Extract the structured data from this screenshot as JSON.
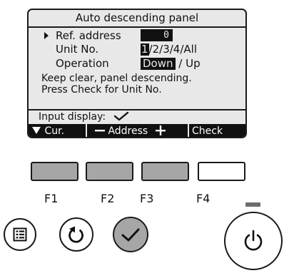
{
  "screen": {
    "title": "Auto descending panel",
    "ref_address_label": "Ref. address",
    "ref_address_value": "0",
    "unit_no_label": "Unit No.",
    "unit_no_selected": "1",
    "unit_no_rest": "/2/3/4/All",
    "operation_label": "Operation",
    "operation_selected": "Down",
    "operation_rest": " / Up",
    "message_line1": "Keep clear, panel descending.",
    "message_line2": "Press Check for Unit No.",
    "input_display_label": "Input display:",
    "function_keys": {
      "f1": "Cur.",
      "f2_left": "Address",
      "f4": "Check"
    }
  },
  "buttons": {
    "f1": "F1",
    "f2": "F2",
    "f3": "F3",
    "f4": "F4"
  },
  "icons": {
    "cursor": "triangle-right-icon",
    "input_check": "check-icon",
    "f1_arrow": "triangle-down-icon",
    "minus": "minus-icon",
    "plus": "plus-icon",
    "menu": "menu-icon",
    "return": "return-icon",
    "confirm": "check-icon",
    "power": "power-icon"
  },
  "colors": {
    "lcd_background": "#e8e8e8",
    "inverse_text": "#111111",
    "gray_button": "#a6a6a6",
    "led": "#6e6e6e"
  }
}
